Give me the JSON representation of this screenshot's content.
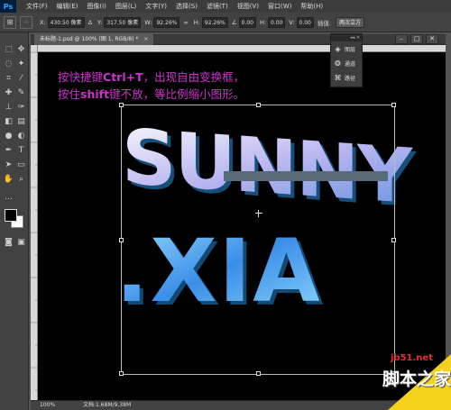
{
  "app": {
    "logo": "Ps"
  },
  "menu": {
    "items": [
      "文件(F)",
      "编辑(E)",
      "图像(I)",
      "图层(L)",
      "文字(Y)",
      "选择(S)",
      "滤镜(T)",
      "视图(V)",
      "窗口(W)",
      "帮助(H)"
    ]
  },
  "options": {
    "x_label": "X:",
    "x_value": "430.50 像素",
    "y_label": "Y:",
    "y_value": "317.50 像素",
    "w_label": "W:",
    "w_value": "92.26%",
    "h_label": "H:",
    "h_value": "92.26%",
    "angle_value": "0.00",
    "h_skew_label": "H:",
    "h_skew_value": "0.00",
    "v_skew_label": "V:",
    "v_skew_value": "0.00",
    "interp_label": "插值:",
    "interp_value": "两次立方"
  },
  "document": {
    "tab_label": "未标题-1.psd @ 100% (图 1, RGB/8) *",
    "close": "×"
  },
  "canvas": {
    "line1_pre": "按快捷键",
    "line1_key": "Ctrl+T",
    "line1_post": "，出现自由变换框，",
    "line2_pre": "按住",
    "line2_key": "shift",
    "line2_post": "键不放，等比例缩小图形。",
    "art_line1": "SUNNY",
    "art_line2": ".XIA"
  },
  "panel": {
    "collapse": "◂◂ ✕",
    "items": [
      {
        "label": "图层",
        "icon": "layers-icon"
      },
      {
        "label": "通道",
        "icon": "channels-icon"
      },
      {
        "label": "路径",
        "icon": "paths-icon"
      }
    ]
  },
  "status": {
    "zoom": "100%",
    "doc_info": "文档:1.68M/9.38M"
  },
  "watermark": {
    "site": "jb51.net",
    "name": "脚本之家"
  },
  "colors": {
    "instruction_text": "#cc33cc",
    "watermark_bg": "#f5d21a",
    "canvas_bg": "#000000"
  }
}
